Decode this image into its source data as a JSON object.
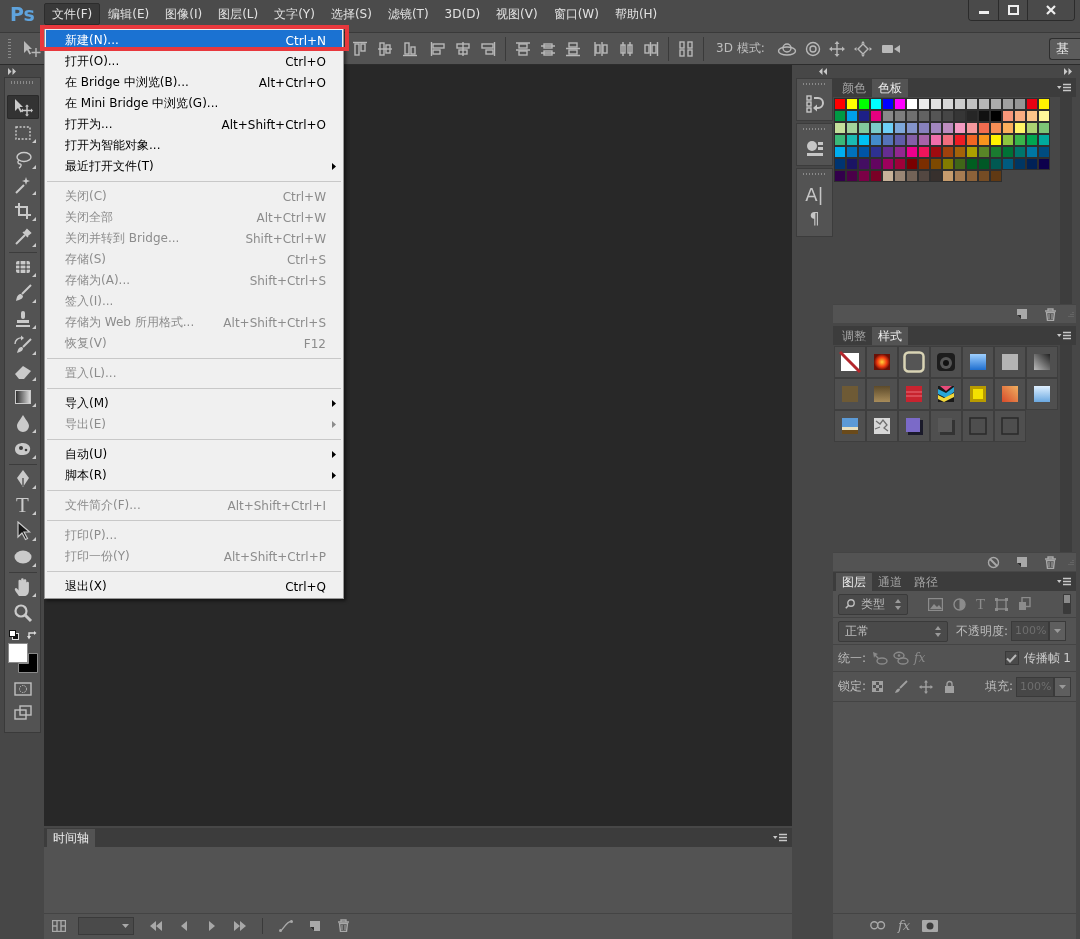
{
  "app_logo": "Ps",
  "menubar": {
    "items": [
      {
        "label": "文件(F)",
        "selected": true
      },
      {
        "label": "编辑(E)",
        "selected": false
      },
      {
        "label": "图像(I)",
        "selected": false
      },
      {
        "label": "图层(L)",
        "selected": false
      },
      {
        "label": "文字(Y)",
        "selected": false
      },
      {
        "label": "选择(S)",
        "selected": false
      },
      {
        "label": "滤镜(T)",
        "selected": false
      },
      {
        "label": "3D(D)",
        "selected": false
      },
      {
        "label": "视图(V)",
        "selected": false
      },
      {
        "label": "窗口(W)",
        "selected": false
      },
      {
        "label": "帮助(H)",
        "selected": false
      }
    ]
  },
  "options_bar": {
    "mode_label": "3D 模式:",
    "workspace_button": "基"
  },
  "toolbar": {
    "groups": [
      {
        "tools": [
          {
            "kind": "move",
            "selected": true,
            "more_tools": false
          },
          {
            "kind": "marquee",
            "selected": false,
            "more_tools": true
          },
          {
            "kind": "lasso",
            "selected": false,
            "more_tools": true
          },
          {
            "kind": "wand",
            "selected": false,
            "more_tools": true
          },
          {
            "kind": "crop",
            "selected": false,
            "more_tools": true
          },
          {
            "kind": "eyedropper",
            "selected": false,
            "more_tools": true
          }
        ]
      },
      {
        "tools": [
          {
            "kind": "heal",
            "selected": false,
            "more_tools": true
          },
          {
            "kind": "brush",
            "selected": false,
            "more_tools": true
          },
          {
            "kind": "stamp",
            "selected": false,
            "more_tools": true
          },
          {
            "kind": "historybrush",
            "selected": false,
            "more_tools": true
          },
          {
            "kind": "eraser",
            "selected": false,
            "more_tools": true
          },
          {
            "kind": "gradient",
            "selected": false,
            "more_tools": true
          },
          {
            "kind": "blur",
            "selected": false,
            "more_tools": true
          },
          {
            "kind": "sponge",
            "selected": false,
            "more_tools": true
          }
        ]
      },
      {
        "tools": [
          {
            "kind": "pen",
            "selected": false,
            "more_tools": true
          },
          {
            "kind": "type",
            "glyph": "T",
            "selected": false,
            "more_tools": true
          },
          {
            "kind": "pathselect",
            "selected": false,
            "more_tools": true
          },
          {
            "kind": "ellipse",
            "selected": false,
            "more_tools": true
          }
        ]
      },
      {
        "tools": [
          {
            "kind": "hand",
            "selected": false,
            "more_tools": true
          },
          {
            "kind": "zoom",
            "selected": false,
            "more_tools": false
          }
        ]
      }
    ],
    "color_chips": [
      {
        "color": "#ffffff"
      },
      {
        "color": "#000000"
      }
    ]
  },
  "file_menu": {
    "groups": [
      {
        "items": [
          {
            "label": "新建(N)...",
            "shortcut": "Ctrl+N",
            "submenu": false,
            "disabled": false,
            "selected": true,
            "outlined": true
          },
          {
            "label": "打开(O)...",
            "shortcut": "Ctrl+O",
            "submenu": false,
            "disabled": false,
            "selected": false,
            "outlined": false
          },
          {
            "label": "在 Bridge 中浏览(B)...",
            "shortcut": "Alt+Ctrl+O",
            "submenu": false,
            "disabled": false,
            "selected": false,
            "outlined": false
          },
          {
            "label": "在 Mini Bridge 中浏览(G)...",
            "submenu": false,
            "disabled": false,
            "selected": false,
            "outlined": false
          },
          {
            "label": "打开为...",
            "shortcut": "Alt+Shift+Ctrl+O",
            "submenu": false,
            "disabled": false,
            "selected": false,
            "outlined": false
          },
          {
            "label": "打开为智能对象...",
            "submenu": false,
            "disabled": false,
            "selected": false,
            "outlined": false
          },
          {
            "label": "最近打开文件(T)",
            "submenu": true,
            "disabled": false,
            "selected": false,
            "outlined": false
          }
        ]
      },
      {
        "items": [
          {
            "label": "关闭(C)",
            "shortcut": "Ctrl+W",
            "submenu": false,
            "disabled": true,
            "selected": false,
            "outlined": false
          },
          {
            "label": "关闭全部",
            "shortcut": "Alt+Ctrl+W",
            "submenu": false,
            "disabled": true,
            "selected": false,
            "outlined": false
          },
          {
            "label": "关闭并转到 Bridge...",
            "shortcut": "Shift+Ctrl+W",
            "submenu": false,
            "disabled": true,
            "selected": false,
            "outlined": false
          },
          {
            "label": "存储(S)",
            "shortcut": "Ctrl+S",
            "submenu": false,
            "disabled": true,
            "selected": false,
            "outlined": false
          },
          {
            "label": "存储为(A)...",
            "shortcut": "Shift+Ctrl+S",
            "submenu": false,
            "disabled": true,
            "selected": false,
            "outlined": false
          },
          {
            "label": "签入(I)...",
            "submenu": false,
            "disabled": true,
            "selected": false,
            "outlined": false
          },
          {
            "label": "存储为 Web 所用格式...",
            "shortcut": "Alt+Shift+Ctrl+S",
            "submenu": false,
            "disabled": true,
            "selected": false,
            "outlined": false
          },
          {
            "label": "恢复(V)",
            "shortcut": "F12",
            "submenu": false,
            "disabled": true,
            "selected": false,
            "outlined": false
          }
        ]
      },
      {
        "items": [
          {
            "label": "置入(L)...",
            "submenu": false,
            "disabled": true,
            "selected": false,
            "outlined": false
          }
        ]
      },
      {
        "items": [
          {
            "label": "导入(M)",
            "submenu": true,
            "disabled": false,
            "selected": false,
            "outlined": false
          },
          {
            "label": "导出(E)",
            "submenu": true,
            "disabled": true,
            "selected": false,
            "outlined": false
          }
        ]
      },
      {
        "items": [
          {
            "label": "自动(U)",
            "submenu": true,
            "disabled": false,
            "selected": false,
            "outlined": false
          },
          {
            "label": "脚本(R)",
            "submenu": true,
            "disabled": false,
            "selected": false,
            "outlined": false
          }
        ]
      },
      {
        "items": [
          {
            "label": "文件简介(F)...",
            "shortcut": "Alt+Shift+Ctrl+I",
            "submenu": false,
            "disabled": true,
            "selected": false,
            "outlined": false
          }
        ]
      },
      {
        "items": [
          {
            "label": "打印(P)...",
            "submenu": false,
            "disabled": true,
            "selected": false,
            "outlined": false
          },
          {
            "label": "打印一份(Y)",
            "shortcut": "Alt+Shift+Ctrl+P",
            "submenu": false,
            "disabled": true,
            "selected": false,
            "outlined": false
          }
        ]
      },
      {
        "items": [
          {
            "label": "退出(X)",
            "shortcut": "Ctrl+Q",
            "submenu": false,
            "disabled": false,
            "selected": false,
            "outlined": false
          }
        ]
      }
    ]
  },
  "dock": {
    "character_glyph": "A|",
    "paragraph_glyph": "¶"
  },
  "swatches_panel": {
    "tabs": [
      {
        "label": "颜色",
        "selected": false
      },
      {
        "label": "色板",
        "selected": true
      }
    ],
    "swatches": [
      {
        "color": "#ff0000"
      },
      {
        "color": "#ffff00"
      },
      {
        "color": "#00ff00"
      },
      {
        "color": "#00ffff"
      },
      {
        "color": "#0000ff"
      },
      {
        "color": "#ff00ff"
      },
      {
        "color": "#ffffff"
      },
      {
        "color": "#ebebeb"
      },
      {
        "color": "#e1e1e1"
      },
      {
        "color": "#d7d7d7"
      },
      {
        "color": "#cccccc"
      },
      {
        "color": "#c2c2c2"
      },
      {
        "color": "#b7b7b7"
      },
      {
        "color": "#acacac"
      },
      {
        "color": "#a0a0a0"
      },
      {
        "color": "#959595"
      },
      {
        "color": "#e60012"
      },
      {
        "color": "#fff100"
      },
      {
        "color": "#009944"
      },
      {
        "color": "#00a0e9"
      },
      {
        "color": "#1d2088"
      },
      {
        "color": "#e4007f"
      },
      {
        "color": "#898989"
      },
      {
        "color": "#7d7d7d"
      },
      {
        "color": "#707070"
      },
      {
        "color": "#626262"
      },
      {
        "color": "#555555"
      },
      {
        "color": "#464646"
      },
      {
        "color": "#363636"
      },
      {
        "color": "#262626"
      },
      {
        "color": "#111111"
      },
      {
        "color": "#000000"
      },
      {
        "color": "#f7977a"
      },
      {
        "color": "#f9ad81"
      },
      {
        "color": "#fdc68a"
      },
      {
        "color": "#fff79a"
      },
      {
        "color": "#c4df9b"
      },
      {
        "color": "#a3d39c"
      },
      {
        "color": "#82ca9d"
      },
      {
        "color": "#7accc8"
      },
      {
        "color": "#6dcff6"
      },
      {
        "color": "#7da7d9"
      },
      {
        "color": "#8393ca"
      },
      {
        "color": "#8781bd"
      },
      {
        "color": "#a186be"
      },
      {
        "color": "#bd8cbf"
      },
      {
        "color": "#f49ac1"
      },
      {
        "color": "#f5989d"
      },
      {
        "color": "#f26c4f"
      },
      {
        "color": "#f68e55"
      },
      {
        "color": "#fbaf5c"
      },
      {
        "color": "#fff467"
      },
      {
        "color": "#acd372"
      },
      {
        "color": "#7cc576"
      },
      {
        "color": "#3bb878"
      },
      {
        "color": "#1abbb4"
      },
      {
        "color": "#00bff3"
      },
      {
        "color": "#438ccb"
      },
      {
        "color": "#5574b9"
      },
      {
        "color": "#605ca8"
      },
      {
        "color": "#855fa8"
      },
      {
        "color": "#a763a8"
      },
      {
        "color": "#f06eaa"
      },
      {
        "color": "#f26d7d"
      },
      {
        "color": "#ed1c24"
      },
      {
        "color": "#f26522"
      },
      {
        "color": "#f7941d"
      },
      {
        "color": "#fff200"
      },
      {
        "color": "#8dc73f"
      },
      {
        "color": "#39b54a"
      },
      {
        "color": "#00a651"
      },
      {
        "color": "#00a99d"
      },
      {
        "color": "#00aeef"
      },
      {
        "color": "#0072bc"
      },
      {
        "color": "#0054a6"
      },
      {
        "color": "#2e3192"
      },
      {
        "color": "#662d91"
      },
      {
        "color": "#92278f"
      },
      {
        "color": "#ec008c"
      },
      {
        "color": "#ed145b"
      },
      {
        "color": "#9e0b0f"
      },
      {
        "color": "#a0410d"
      },
      {
        "color": "#a36209"
      },
      {
        "color": "#aba000"
      },
      {
        "color": "#598527"
      },
      {
        "color": "#1a7b30"
      },
      {
        "color": "#007236"
      },
      {
        "color": "#00746b"
      },
      {
        "color": "#0076a3"
      },
      {
        "color": "#004b80"
      },
      {
        "color": "#003471"
      },
      {
        "color": "#1b1464"
      },
      {
        "color": "#440e62"
      },
      {
        "color": "#630460"
      },
      {
        "color": "#9e005d"
      },
      {
        "color": "#9e0039"
      },
      {
        "color": "#790000"
      },
      {
        "color": "#7b2e00"
      },
      {
        "color": "#7d4900"
      },
      {
        "color": "#827b00"
      },
      {
        "color": "#406618"
      },
      {
        "color": "#005e20"
      },
      {
        "color": "#005826"
      },
      {
        "color": "#005952"
      },
      {
        "color": "#005b7f"
      },
      {
        "color": "#003663"
      },
      {
        "color": "#002157"
      },
      {
        "color": "#0d004c"
      },
      {
        "color": "#32004b"
      },
      {
        "color": "#4b0049"
      },
      {
        "color": "#7b0046"
      },
      {
        "color": "#7a0026"
      },
      {
        "color": "#c7b299"
      },
      {
        "color": "#998675"
      },
      {
        "color": "#736357"
      },
      {
        "color": "#534741"
      },
      {
        "color": "#37302d"
      },
      {
        "color": "#c69c6d"
      },
      {
        "color": "#a67c52"
      },
      {
        "color": "#8c6239"
      },
      {
        "color": "#754c24"
      },
      {
        "color": "#603913"
      }
    ]
  },
  "styles_panel": {
    "tabs": [
      {
        "label": "调整",
        "selected": false
      },
      {
        "label": "样式",
        "selected": true
      }
    ]
  },
  "layers_panel": {
    "tabs": [
      {
        "label": "图层",
        "selected": true
      },
      {
        "label": "通道",
        "selected": false
      },
      {
        "label": "路径",
        "selected": false
      }
    ],
    "filter": {
      "value": "类型",
      "text_glyph": "T"
    },
    "blend_mode": {
      "value": "正常"
    },
    "opacity": {
      "label": "不透明度:",
      "value": "100%",
      "disabled": true
    },
    "unify": {
      "label": "统一:",
      "style_glyph": "fx"
    },
    "propagate": {
      "label": "传播帧 1",
      "checked": true
    },
    "lock": {
      "label": "锁定:"
    },
    "fill": {
      "label": "填充:",
      "value": "100%",
      "disabled": true
    },
    "footer": {
      "style_glyph": "fx"
    }
  },
  "timeline_panel": {
    "tabs": [
      {
        "label": "时间轴",
        "selected": true
      }
    ]
  }
}
